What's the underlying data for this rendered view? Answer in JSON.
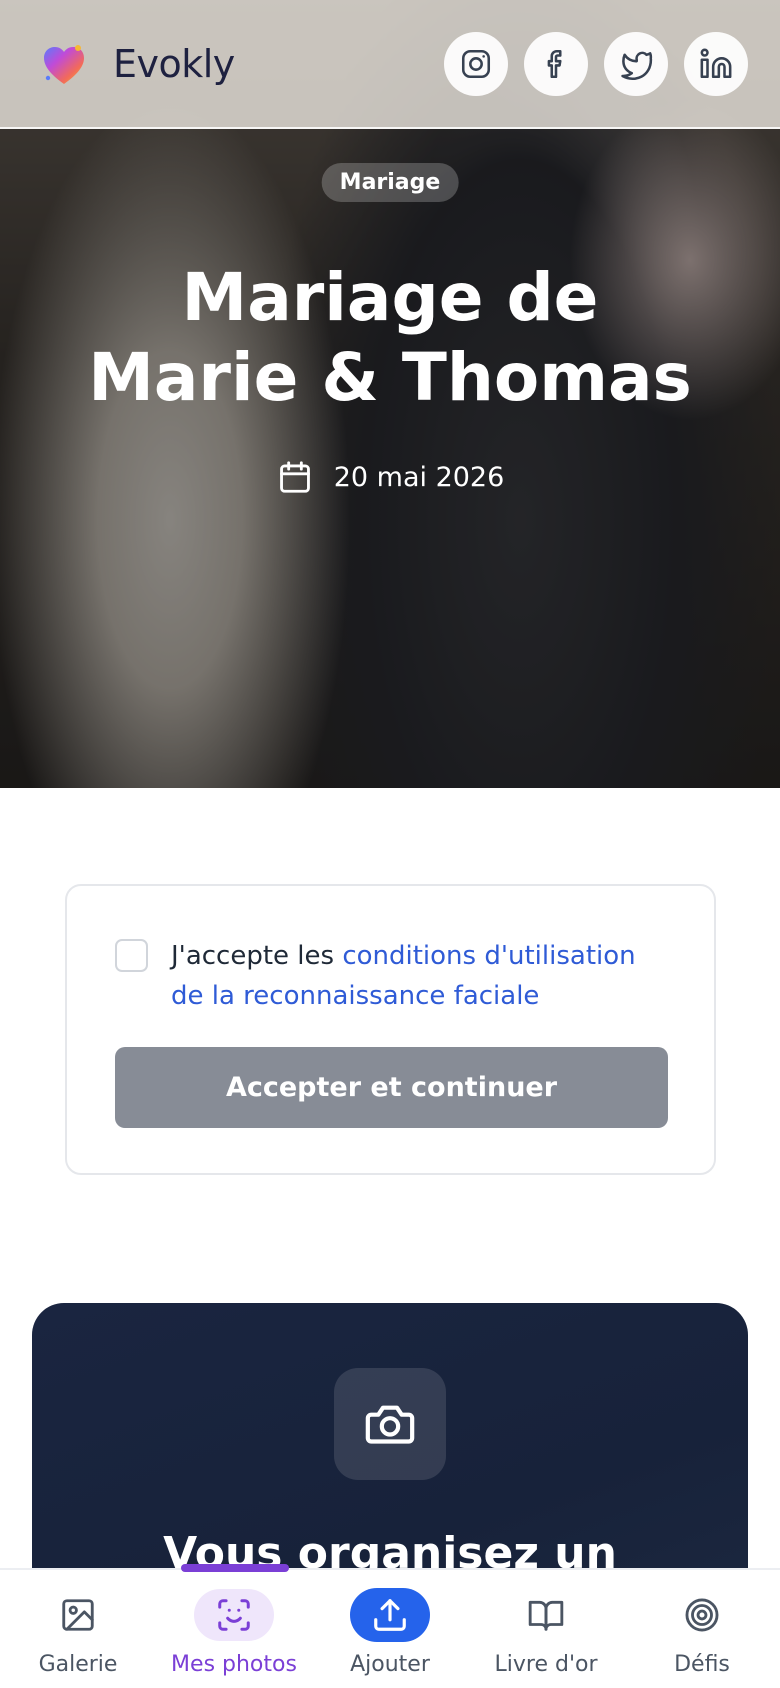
{
  "header": {
    "brand": "Evokly",
    "social": [
      {
        "icon": "instagram-icon"
      },
      {
        "icon": "facebook-icon"
      },
      {
        "icon": "twitter-icon"
      },
      {
        "icon": "linkedin-icon"
      }
    ]
  },
  "hero": {
    "badge": "Mariage",
    "title_line1": "Mariage de",
    "title_line2": "Marie & Thomas",
    "date": "20 mai 2026",
    "date_icon": "calendar-icon"
  },
  "consent": {
    "checked": false,
    "text_prefix": "J'accepte les ",
    "link_text": "conditions d'utilisation de la reconnaissance faciale",
    "button_label": "Accepter et continuer"
  },
  "promo": {
    "icon": "camera-icon",
    "title": "Vous organisez un"
  },
  "bottom_nav": {
    "items": [
      {
        "label": "Galerie",
        "icon": "image-icon",
        "active": false
      },
      {
        "label": "Mes photos",
        "icon": "face-scan-icon",
        "active": true
      },
      {
        "label": "Ajouter",
        "icon": "upload-icon",
        "active": false
      },
      {
        "label": "Livre d'or",
        "icon": "book-icon",
        "active": false
      },
      {
        "label": "Défis",
        "icon": "target-icon",
        "active": false
      }
    ]
  },
  "colors": {
    "accent_purple": "#7b3fd6",
    "accent_blue": "#2563eb",
    "link_blue": "#2f5bd6",
    "button_disabled": "#878c96",
    "promo_bg": "#1a2540"
  }
}
